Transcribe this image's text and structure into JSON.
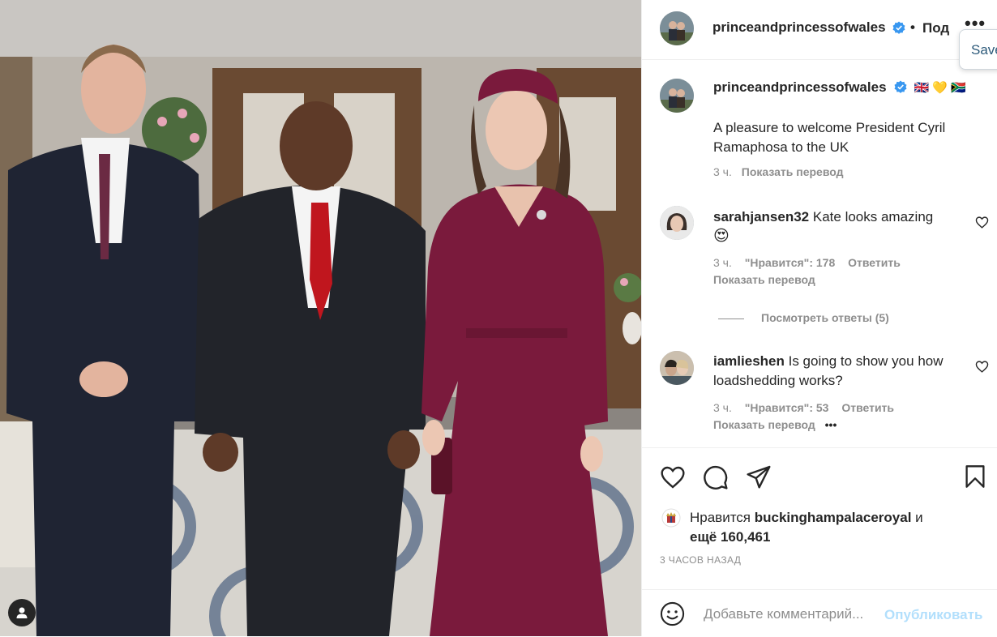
{
  "post": {
    "author": "princeandprincessofwales",
    "follow_label": "Под",
    "save_tooltip": "Save",
    "caption": {
      "flags": "🇬🇧 💛 🇿🇦",
      "text": "A pleasure to welcome President Cyril Ramaphosa to the UK",
      "time": "3 ч.",
      "translate": "Показать перевод"
    }
  },
  "comments": [
    {
      "username": "sarahjansen32",
      "text": "Kate looks amazing",
      "emoji": "😍",
      "time": "3 ч.",
      "likes": "\"Нравится\": 178",
      "reply": "Ответить",
      "translate": "Показать перевод",
      "view_replies": "Посмотреть ответы (5)"
    },
    {
      "username": "iamlieshen",
      "text": "Is going to show you how loadshedding works?",
      "time": "3 ч.",
      "likes": "\"Нравится\": 53",
      "reply": "Ответить",
      "translate": "Показать перевод",
      "more": "•••"
    }
  ],
  "likes": {
    "prefix": "Нравится",
    "user": "buckinghampalaceroyal",
    "conj": "и",
    "rest": "ещё 160,461"
  },
  "time_ago": "3 ЧАСОВ НАЗАД",
  "comment_box": {
    "placeholder": "Добавьте комментарий...",
    "publish": "Опубликовать"
  },
  "icons": {
    "verified": "verified-badge-icon",
    "like": "heart-icon",
    "comment": "comment-bubble-icon",
    "share": "paper-plane-icon",
    "save": "bookmark-icon",
    "emoji": "smiley-icon",
    "more": "ellipsis-icon",
    "tag": "user-tag-icon"
  },
  "colors": {
    "verified": "#3897f0",
    "publish_disabled": "#b2dffc",
    "meta": "#8e8e8e",
    "dress": "#7a1a3c"
  }
}
